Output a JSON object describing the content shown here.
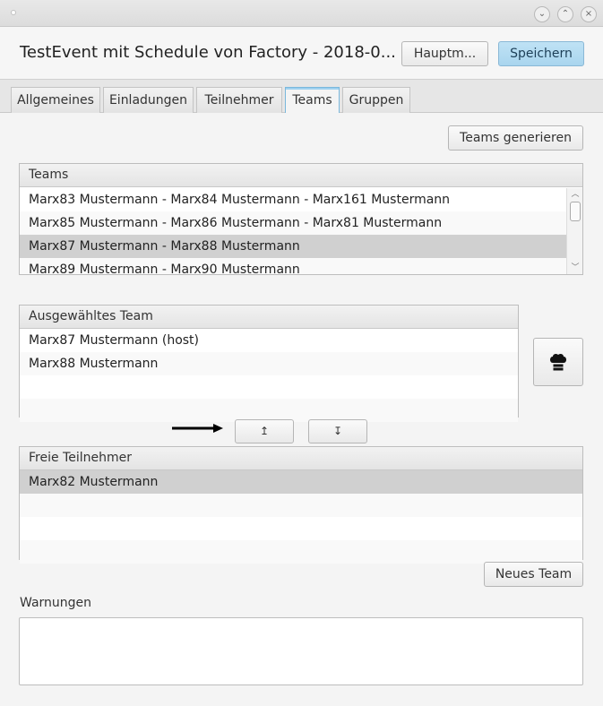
{
  "window": {
    "buttons": [
      {
        "name": "minimize",
        "glyph": "⌄"
      },
      {
        "name": "maximize",
        "glyph": "⌃"
      },
      {
        "name": "close",
        "glyph": "×"
      }
    ]
  },
  "header": {
    "title": "TestEvent mit Schedule von Factory - 2018-0...",
    "main_button": "Hauptm...",
    "save_button": "Speichern"
  },
  "tabs": [
    {
      "label": "Allgemeines",
      "active": false
    },
    {
      "label": "Einladungen",
      "active": false
    },
    {
      "label": "Teilnehmer",
      "active": false
    },
    {
      "label": "Teams",
      "active": true
    },
    {
      "label": "Gruppen",
      "active": false
    }
  ],
  "toolbar": {
    "generate_teams": "Teams generieren"
  },
  "teams_list": {
    "header": "Teams",
    "items": [
      "Marx83 Mustermann - Marx84 Mustermann - Marx161 Mustermann",
      "Marx85 Mustermann - Marx86 Mustermann - Marx81 Mustermann",
      "Marx87 Mustermann - Marx88 Mustermann",
      "Marx89 Mustermann - Marx90 Mustermann"
    ],
    "selected_index": 2
  },
  "selected_team": {
    "header": "Ausgewähltes Team",
    "members": [
      "Marx87 Mustermann (host)",
      "Marx88 Mustermann"
    ],
    "cook_icon": "chef-hat-icon"
  },
  "move_buttons": {
    "up_glyph": "↥",
    "down_glyph": "↧"
  },
  "free_participants": {
    "header": "Freie Teilnehmer",
    "items": [
      "Marx82 Mustermann"
    ],
    "selected_index": 0
  },
  "new_team_button": "Neues Team",
  "warnings": {
    "label": "Warnungen",
    "value": ""
  },
  "colors": {
    "accent": "#a9d5ee",
    "selection": "#d0d0d0",
    "tab_active_border": "#7ab8dc"
  }
}
